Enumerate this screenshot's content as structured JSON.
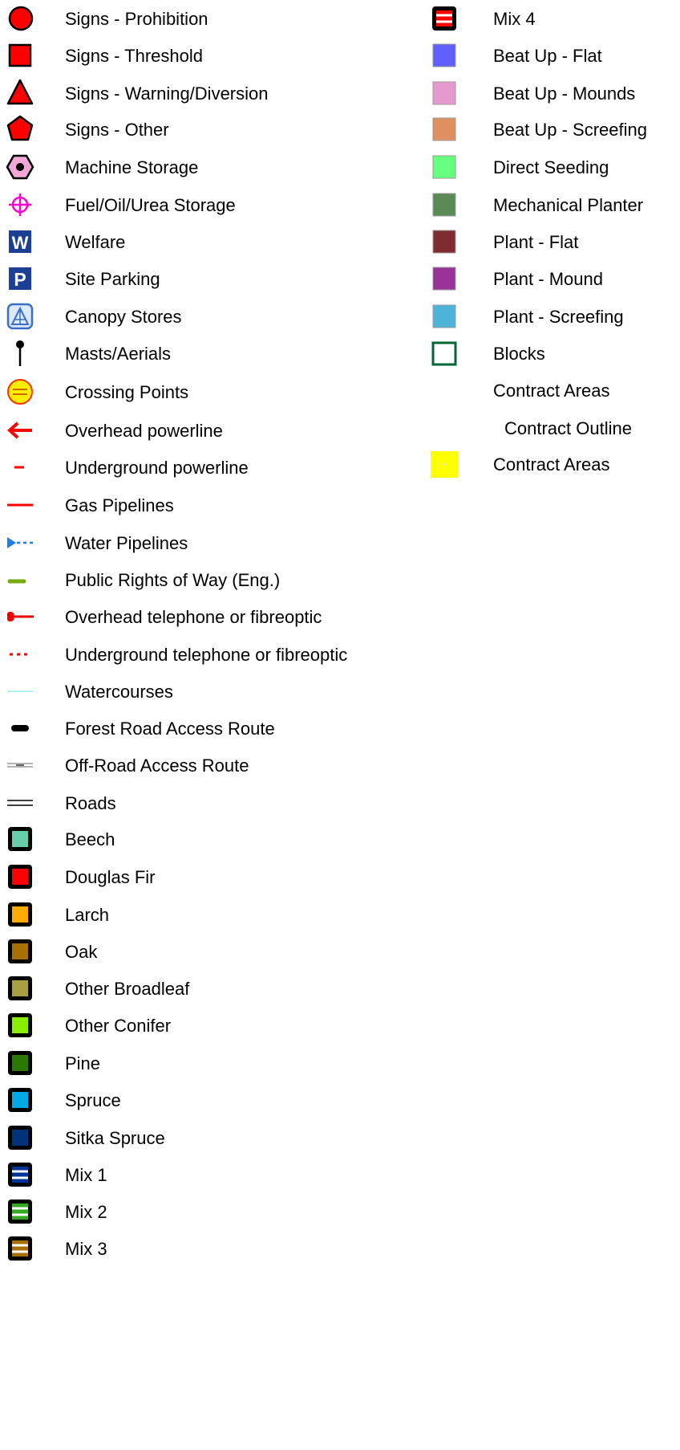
{
  "legend": {
    "left": [
      {
        "label": "Signs - Prohibition",
        "icon": "prohibition-sign-icon"
      },
      {
        "label": "Signs - Threshold",
        "icon": "threshold-sign-icon"
      },
      {
        "label": "Signs - Warning/Diversion",
        "icon": "warning-sign-icon"
      },
      {
        "label": "Signs - Other",
        "icon": "other-sign-icon"
      },
      {
        "label": "Machine Storage",
        "icon": "machine-storage-icon"
      },
      {
        "label": "Fuel/Oil/Urea Storage",
        "icon": "fuel-storage-icon"
      },
      {
        "label": "Welfare",
        "icon": "welfare-icon",
        "glyph": "W"
      },
      {
        "label": "Site Parking",
        "icon": "parking-icon",
        "glyph": "P"
      },
      {
        "label": "Canopy Stores",
        "icon": "canopy-stores-icon"
      },
      {
        "label": "Masts/Aerials",
        "icon": "mast-icon"
      },
      {
        "label": "Crossing Points",
        "icon": "crossing-point-icon"
      },
      {
        "label": "Overhead powerline",
        "icon": "overhead-powerline-icon"
      },
      {
        "label": "Underground powerline",
        "icon": "underground-powerline-icon"
      },
      {
        "label": "Gas Pipelines",
        "icon": "gas-pipeline-icon"
      },
      {
        "label": "Water Pipelines",
        "icon": "water-pipeline-icon"
      },
      {
        "label": "Public Rights of Way (Eng.)",
        "icon": "public-right-of-way-icon"
      },
      {
        "label": "Overhead telephone or fibreoptic",
        "icon": "overhead-telephone-icon"
      },
      {
        "label": "Underground telephone or fibreoptic",
        "icon": "underground-telephone-icon"
      },
      {
        "label": "Watercourses",
        "icon": "watercourse-icon"
      },
      {
        "label": "Forest Road Access Route",
        "icon": "forest-road-icon"
      },
      {
        "label": "Off-Road Access Route",
        "icon": "off-road-route-icon"
      },
      {
        "label": "Roads",
        "icon": "roads-icon"
      },
      {
        "label": "Beech",
        "icon": "beech-swatch-icon",
        "color": "#66ccaa"
      },
      {
        "label": "Douglas Fir",
        "icon": "douglas-fir-swatch-icon",
        "color": "#ff0000"
      },
      {
        "label": "Larch",
        "icon": "larch-swatch-icon",
        "color": "#ffaa00"
      },
      {
        "label": "Oak",
        "icon": "oak-swatch-icon",
        "color": "#a87000"
      },
      {
        "label": "Other Broadleaf",
        "icon": "other-broadleaf-swatch-icon",
        "color": "#a8a040"
      },
      {
        "label": "Other Conifer",
        "icon": "other-conifer-swatch-icon",
        "color": "#88ee00"
      },
      {
        "label": "Pine",
        "icon": "pine-swatch-icon",
        "color": "#2a7a00"
      },
      {
        "label": "Spruce",
        "icon": "spruce-swatch-icon",
        "color": "#00a8e6"
      },
      {
        "label": "Sitka Spruce",
        "icon": "sitka-spruce-swatch-icon",
        "color": "#00337a"
      },
      {
        "label": "Mix 1",
        "icon": "mix-1-swatch-icon",
        "color": "#003399"
      },
      {
        "label": "Mix 2",
        "icon": "mix-2-swatch-icon",
        "color": "#33aa22"
      },
      {
        "label": "Mix 3",
        "icon": "mix-3-swatch-icon",
        "color": "#a87000"
      }
    ],
    "right": [
      {
        "label": "Mix 4",
        "icon": "mix-4-swatch-icon",
        "color": "#ff0000"
      },
      {
        "label": "Beat Up - Flat",
        "icon": "beat-up-flat-swatch-icon",
        "color": "#6060ff"
      },
      {
        "label": "Beat Up - Mounds",
        "icon": "beat-up-mounds-swatch-icon",
        "color": "#e699cc"
      },
      {
        "label": "Beat Up - Screefing",
        "icon": "beat-up-screefing-swatch-icon",
        "color": "#e09060"
      },
      {
        "label": "Direct Seeding",
        "icon": "direct-seeding-swatch-icon",
        "color": "#66ff7f"
      },
      {
        "label": "Mechanical Planter",
        "icon": "mechanical-planter-swatch-icon",
        "color": "#5a8a55"
      },
      {
        "label": "Plant - Flat",
        "icon": "plant-flat-swatch-icon",
        "color": "#802b2f"
      },
      {
        "label": "Plant - Mound",
        "icon": "plant-mound-swatch-icon",
        "color": "#993399"
      },
      {
        "label": "Plant - Screefing",
        "icon": "plant-screefing-swatch-icon",
        "color": "#4db3d9"
      },
      {
        "label": "Blocks",
        "icon": "blocks-outline-icon",
        "color": "#006633"
      },
      {
        "label": "Contract Areas",
        "icon": "none"
      },
      {
        "label": "Contract Outline",
        "icon": "none"
      },
      {
        "label": "Contract Areas",
        "icon": "contract-areas-swatch-icon",
        "color": "#ffff00"
      }
    ]
  }
}
